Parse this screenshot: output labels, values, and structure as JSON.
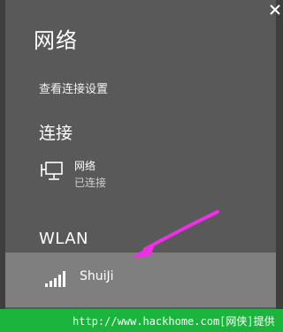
{
  "panel": {
    "title": "网络",
    "settings_link": "查看连接设置",
    "connections_heading": "连接",
    "connection": {
      "name": "网络",
      "status": "已连接",
      "icon": "wired-network-icon"
    },
    "wlan_heading": "WLAN",
    "wifi": {
      "ssid": "ShuiJi",
      "icon": "wifi-signal-icon"
    }
  },
  "footer": {
    "text": "http://www.hackhome.com[网侠]提供"
  },
  "colors": {
    "panel_bg": "#595959",
    "selected_row": "#7f7f7f",
    "arrow": "#ee2fe6",
    "footer": "#1bb53d"
  }
}
